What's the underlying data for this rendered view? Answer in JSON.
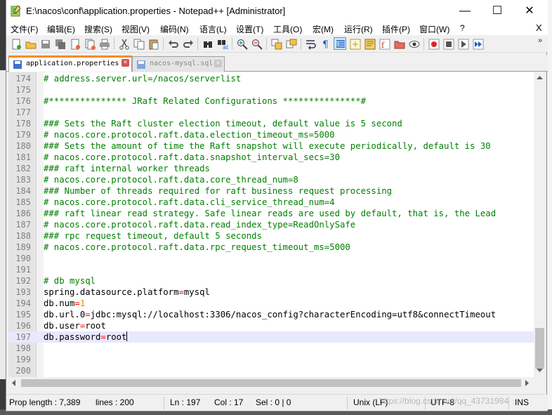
{
  "window": {
    "title": "E:\\nacos\\conf\\application.properties - Notepad++ [Administrator]",
    "min_glyph": "—",
    "max_glyph": "☐",
    "close_glyph": "✕"
  },
  "menu": {
    "items": [
      "文件(F)",
      "编辑(E)",
      "搜索(S)",
      "视图(V)",
      "编码(N)",
      "语言(L)",
      "设置(T)",
      "工具(O)",
      "宏(M)",
      "运行(R)",
      "插件(P)",
      "窗口(W)",
      "?"
    ],
    "close_glyph": "X"
  },
  "toolbar": {
    "overflow_glyph": "»",
    "icons": [
      "new-file-icon",
      "open-file-icon",
      "save-icon",
      "save-all-icon",
      "close-icon",
      "close-all-icon",
      "print-icon",
      "cut-icon",
      "copy-icon",
      "paste-icon",
      "undo-icon",
      "redo-icon",
      "find-icon",
      "replace-icon",
      "zoom-in-icon",
      "zoom-out-icon",
      "sync-vertical-icon",
      "sync-horizontal-icon",
      "word-wrap-icon",
      "show-all-chars-icon",
      "indent-guide-icon",
      "user-lang-icon",
      "doc-map-icon",
      "function-list-icon",
      "folder-workspace-icon",
      "monitor-icon",
      "record-macro-icon",
      "stop-macro-icon",
      "play-macro-icon",
      "run-macro-multiple-icon"
    ]
  },
  "tabs": [
    {
      "label": "application.properties",
      "active": true,
      "close_glyph": "×"
    },
    {
      "label": "nacos-mysql.sql",
      "active": false,
      "close_glyph": "×"
    }
  ],
  "editor": {
    "current_line": 197,
    "lines": [
      {
        "n": "174",
        "kind": "comment",
        "text": "# address.server.url=/nacos/serverlist"
      },
      {
        "n": "175",
        "kind": "blank",
        "text": ""
      },
      {
        "n": "176",
        "kind": "comment",
        "text": "#*************** JRaft Related Configurations ***************#"
      },
      {
        "n": "177",
        "kind": "blank",
        "text": ""
      },
      {
        "n": "178",
        "kind": "comment",
        "text": "### Sets the Raft cluster election timeout, default value is 5 second"
      },
      {
        "n": "179",
        "kind": "comment",
        "text": "# nacos.core.protocol.raft.data.election_timeout_ms=5000"
      },
      {
        "n": "180",
        "kind": "comment",
        "text": "### Sets the amount of time the Raft snapshot will execute periodically, default is 30"
      },
      {
        "n": "181",
        "kind": "comment",
        "text": "# nacos.core.protocol.raft.data.snapshot_interval_secs=30"
      },
      {
        "n": "182",
        "kind": "comment",
        "text": "### raft internal worker threads"
      },
      {
        "n": "183",
        "kind": "comment",
        "text": "# nacos.core.protocol.raft.data.core_thread_num=8"
      },
      {
        "n": "184",
        "kind": "comment",
        "text": "### Number of threads required for raft business request processing"
      },
      {
        "n": "185",
        "kind": "comment",
        "text": "# nacos.core.protocol.raft.data.cli_service_thread_num=4"
      },
      {
        "n": "186",
        "kind": "comment",
        "text": "### raft linear read strategy. Safe linear reads are used by default, that is, the Lead"
      },
      {
        "n": "187",
        "kind": "comment",
        "text": "# nacos.core.protocol.raft.data.read_index_type=ReadOnlySafe"
      },
      {
        "n": "188",
        "kind": "comment",
        "text": "### rpc request timeout, default 5 seconds"
      },
      {
        "n": "189",
        "kind": "comment",
        "text": "# nacos.core.protocol.raft.data.rpc_request_timeout_ms=5000"
      },
      {
        "n": "190",
        "kind": "blank",
        "text": ""
      },
      {
        "n": "191",
        "kind": "blank",
        "text": ""
      },
      {
        "n": "192",
        "kind": "comment",
        "text": "# db mysql"
      },
      {
        "n": "193",
        "kind": "prop",
        "key": "spring.datasource.platform",
        "value": "mysql"
      },
      {
        "n": "194",
        "kind": "prop",
        "key": "db.num",
        "value": "1"
      },
      {
        "n": "195",
        "kind": "prop",
        "key": "db.url.0",
        "value": "jdbc:mysql://localhost:3306/nacos_config?characterEncoding=utf8&connectTimeout"
      },
      {
        "n": "196",
        "kind": "prop",
        "key": "db.user",
        "value": "root"
      },
      {
        "n": "197",
        "kind": "prop",
        "key": "db.password",
        "value": "root"
      },
      {
        "n": "198",
        "kind": "blank",
        "text": ""
      },
      {
        "n": "199",
        "kind": "blank",
        "text": ""
      },
      {
        "n": "200",
        "kind": "blank",
        "text": ""
      }
    ]
  },
  "status": {
    "length": "Prop length : 7,389",
    "lines": "lines : 200",
    "ln": "Ln : 197",
    "col": "Col : 17",
    "sel": "Sel : 0 | 0",
    "eol": "Unix (LF)",
    "encoding": "UTF-8",
    "mode": "INS"
  },
  "watermark": "https://blog.csdn.net/qq_43731984",
  "colors": {
    "comment": "#008000",
    "operator": "#ff0000",
    "active_tab_accent": "#fa8c00",
    "current_line": "#e8e8ff"
  }
}
